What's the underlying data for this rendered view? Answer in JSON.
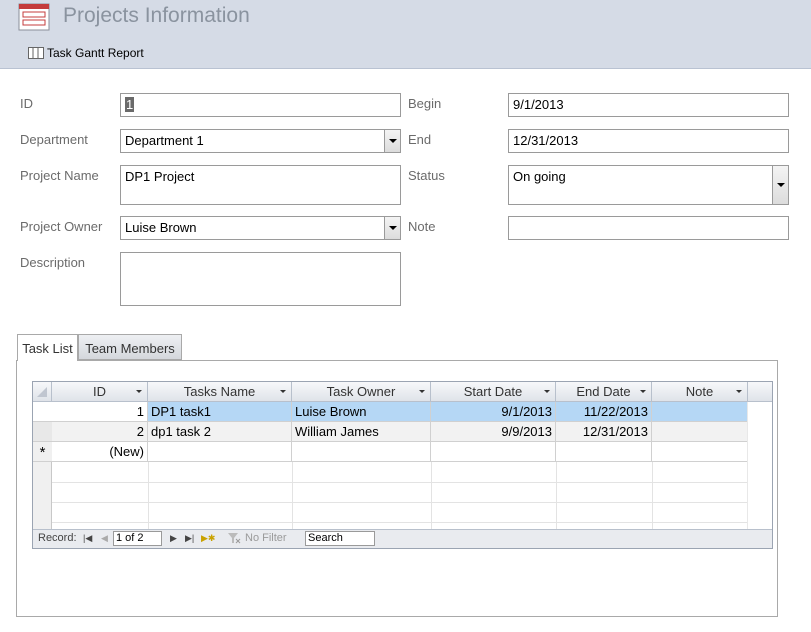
{
  "header": {
    "title": "Projects Information",
    "report_button": "Task Gantt Report"
  },
  "form": {
    "id": {
      "label": "ID",
      "value": "1"
    },
    "department": {
      "label": "Department",
      "value": "Department 1"
    },
    "project_name": {
      "label": "Project Name",
      "value": "DP1 Project"
    },
    "project_owner": {
      "label": "Project Owner",
      "value": "Luise Brown"
    },
    "description": {
      "label": "Description",
      "value": ""
    },
    "begin": {
      "label": "Begin",
      "value": "9/1/2013"
    },
    "end": {
      "label": "End",
      "value": "12/31/2013"
    },
    "status": {
      "label": "Status",
      "value": "On going"
    },
    "note": {
      "label": "Note",
      "value": ""
    }
  },
  "tabs": [
    {
      "label": "Task List",
      "active": true
    },
    {
      "label": "Team Members",
      "active": false
    }
  ],
  "task_table": {
    "columns": [
      "ID",
      "Tasks Name",
      "Task Owner",
      "Start Date",
      "End Date",
      "Note"
    ],
    "rows": [
      {
        "id": "1",
        "name": "DP1 task1",
        "owner": "Luise Brown",
        "start": "9/1/2013",
        "end": "11/22/2013",
        "note": ""
      },
      {
        "id": "2",
        "name": "dp1 task 2",
        "owner": "William James",
        "start": "9/9/2013",
        "end": "12/31/2013",
        "note": ""
      }
    ],
    "new_row_label": "(New)",
    "new_row_marker": "*"
  },
  "navigation": {
    "record_label": "Record:",
    "record_value": "1 of 2",
    "filter_label": "No Filter",
    "search_placeholder": "Search"
  },
  "colors": {
    "header_bg": "#d5dbe6",
    "title": "#8a939f",
    "selected_row": "#b5d7f5"
  }
}
